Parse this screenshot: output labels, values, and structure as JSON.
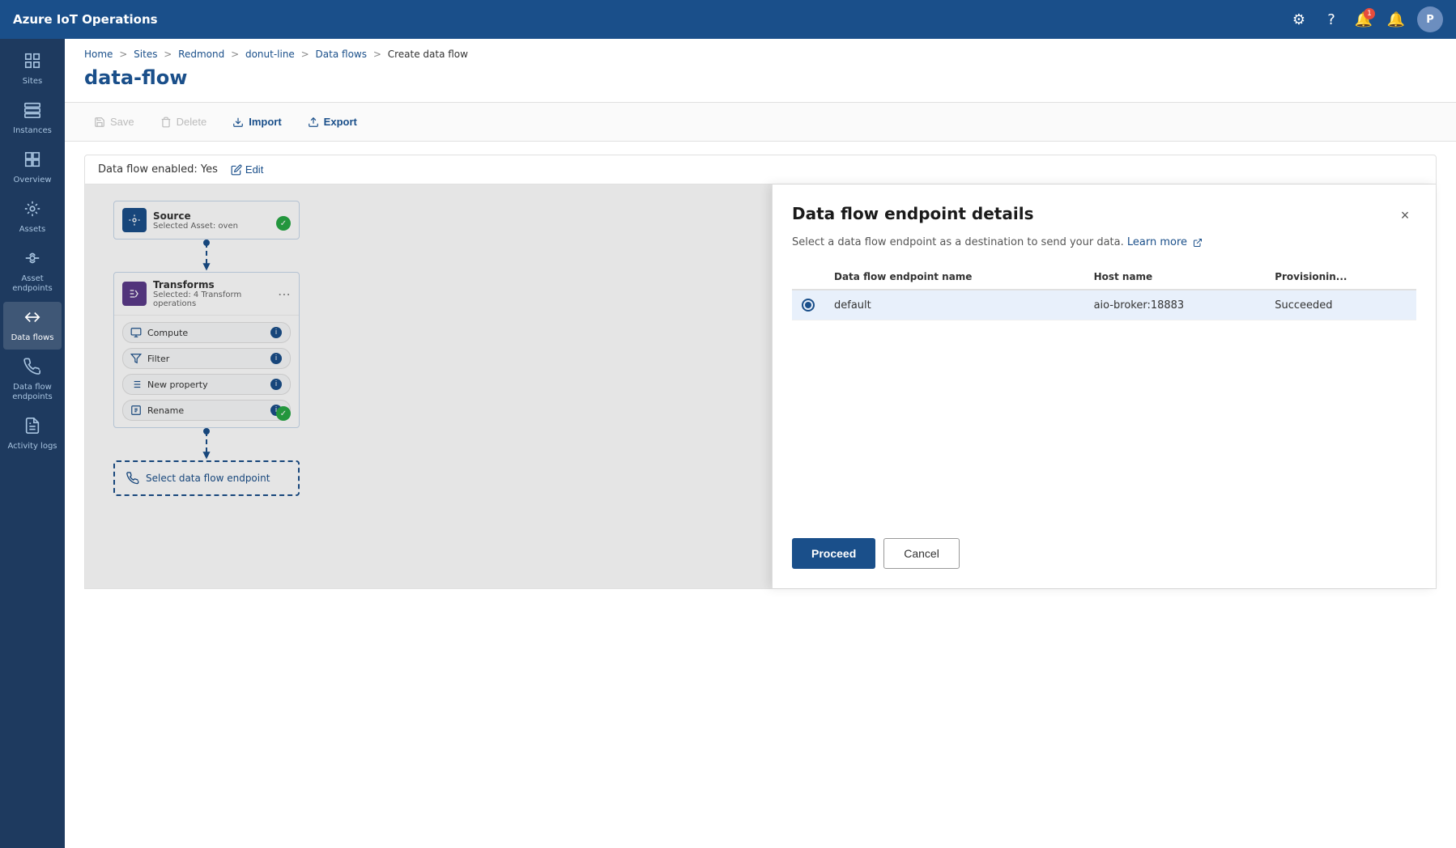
{
  "app": {
    "title": "Azure IoT Operations"
  },
  "topnav": {
    "title": "Azure IoT Operations",
    "avatar_label": "P",
    "notif_count": "1"
  },
  "sidebar": {
    "items": [
      {
        "id": "sites",
        "label": "Sites",
        "icon": "🏠"
      },
      {
        "id": "instances",
        "label": "Instances",
        "icon": "⊞"
      },
      {
        "id": "overview",
        "label": "Overview",
        "icon": "📊"
      },
      {
        "id": "assets",
        "label": "Assets",
        "icon": "🔧"
      },
      {
        "id": "asset-endpoints",
        "label": "Asset endpoints",
        "icon": "🔌"
      },
      {
        "id": "data-flows",
        "label": "Data flows",
        "icon": "⇄"
      },
      {
        "id": "data-flow-endpoints",
        "label": "Data flow endpoints",
        "icon": "📡"
      },
      {
        "id": "activity-logs",
        "label": "Activity logs",
        "icon": "📋"
      }
    ]
  },
  "breadcrumb": {
    "parts": [
      "Home",
      "Sites",
      "Redmond",
      "donut-line",
      "Data flows",
      "Create data flow"
    ],
    "separators": [
      ">",
      ">",
      ">",
      ">",
      ">"
    ]
  },
  "page": {
    "title": "data-flow"
  },
  "toolbar": {
    "save_label": "Save",
    "delete_label": "Delete",
    "import_label": "Import",
    "export_label": "Export"
  },
  "flow": {
    "enabled_label": "Data flow enabled: Yes",
    "edit_label": "Edit",
    "source_node": {
      "title": "Source",
      "subtitle": "Selected Asset: oven"
    },
    "transform_node": {
      "title": "Transforms",
      "subtitle": "Selected: 4 Transform operations"
    },
    "transform_items": [
      {
        "label": "Compute",
        "icon": "⊞"
      },
      {
        "label": "Filter",
        "icon": "⊟"
      },
      {
        "label": "New property",
        "icon": "≡"
      },
      {
        "label": "Rename",
        "icon": "⊡"
      }
    ],
    "endpoint_node": {
      "label": "Select data flow endpoint"
    }
  },
  "modal": {
    "title": "Data flow endpoint details",
    "description": "Select a data flow endpoint as a destination to send your data.",
    "learn_more_label": "Learn more",
    "close_label": "×",
    "table": {
      "columns": [
        "Data flow endpoint name",
        "Host name",
        "Provisionin..."
      ],
      "rows": [
        {
          "selected": true,
          "name": "default",
          "host": "aio-broker:18883",
          "status": "Succeeded"
        }
      ]
    },
    "proceed_label": "Proceed",
    "cancel_label": "Cancel"
  },
  "zoom": {
    "plus": "+",
    "minus": "−",
    "reset": "⊙"
  }
}
